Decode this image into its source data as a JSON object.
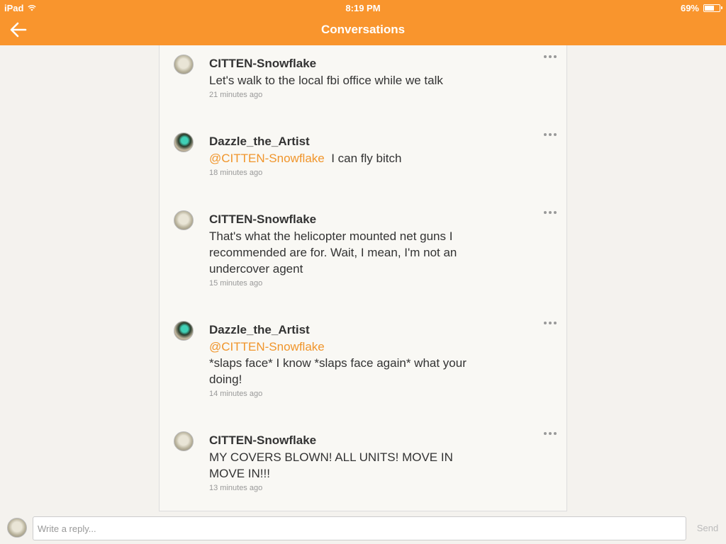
{
  "status": {
    "device": "iPad",
    "time": "8:19 PM",
    "battery": "69%",
    "battery_level": 0.69
  },
  "header": {
    "title": "Conversations",
    "back_icon": "arrow-left-icon"
  },
  "messages": [
    {
      "author": "CITTEN-Snowflake",
      "mention": "",
      "text": "Let's walk to the local fbi office while we talk",
      "time": "21 minutes ago"
    },
    {
      "author": "Dazzle_the_Artist",
      "mention": "@CITTEN-Snowflake",
      "text": "I can fly bitch",
      "time": "18 minutes ago"
    },
    {
      "author": "CITTEN-Snowflake",
      "mention": "",
      "text": "That's what the helicopter mounted net guns I recommended are for. Wait, I mean, I'm not an undercover agent",
      "time": "15 minutes ago"
    },
    {
      "author": "Dazzle_the_Artist",
      "mention": "@CITTEN-Snowflake",
      "text": "*slaps face* I know *slaps face again* what your doing!",
      "time": "14 minutes ago"
    },
    {
      "author": "CITTEN-Snowflake",
      "mention": "",
      "text": "MY COVERS BLOWN! ALL UNITS! MOVE IN MOVE IN!!!",
      "time": "13 minutes ago"
    }
  ],
  "reply": {
    "placeholder": "Write a reply...",
    "send_label": "Send"
  },
  "colors": {
    "accent": "#f9952d",
    "mention": "#f0952b"
  }
}
